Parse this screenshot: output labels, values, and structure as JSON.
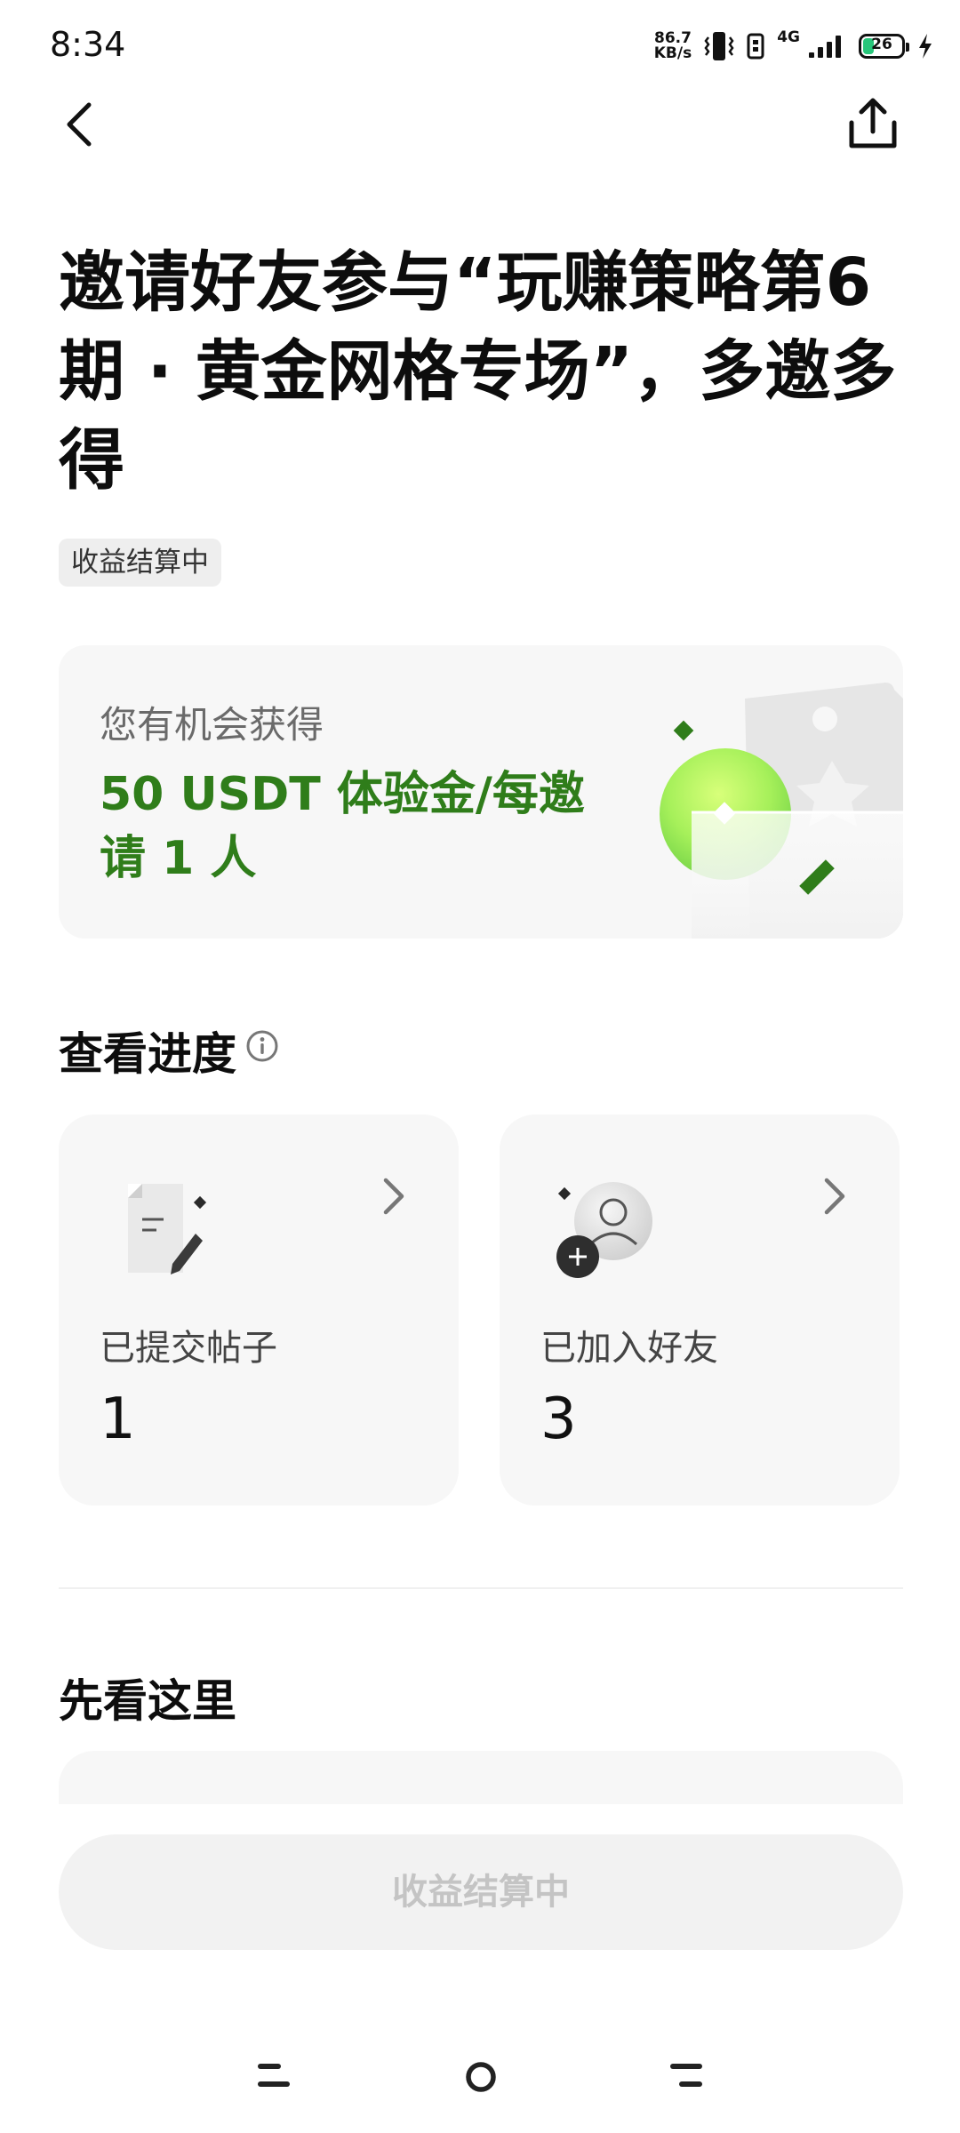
{
  "status_bar": {
    "time": "8:34",
    "net_speed_value": "86.7",
    "net_speed_unit": "KB/s",
    "network_type": "4G",
    "battery_level": "26"
  },
  "nav": {
    "back_icon": "chevron-left-icon",
    "share_icon": "share-icon"
  },
  "title": "邀请好友参与“玩赚策略第6期 · 黄金网格专场”，多邀多得",
  "status_badge": "收益结算中",
  "reward": {
    "label": "您有机会获得",
    "amount": "50 USDT 体验金/每邀请 1 人"
  },
  "progress": {
    "title": "查看进度",
    "cards": [
      {
        "label": "已提交帖子",
        "value": "1",
        "icon": "post-edit-icon"
      },
      {
        "label": "已加入好友",
        "value": "3",
        "icon": "add-friend-icon"
      }
    ]
  },
  "see_here": {
    "title": "先看这里"
  },
  "bottom_button": "收益结算中",
  "colors": {
    "accent_green": "#2f7d1a",
    "card_bg": "#f7f7f7",
    "disabled_text": "#c4c4c4"
  }
}
